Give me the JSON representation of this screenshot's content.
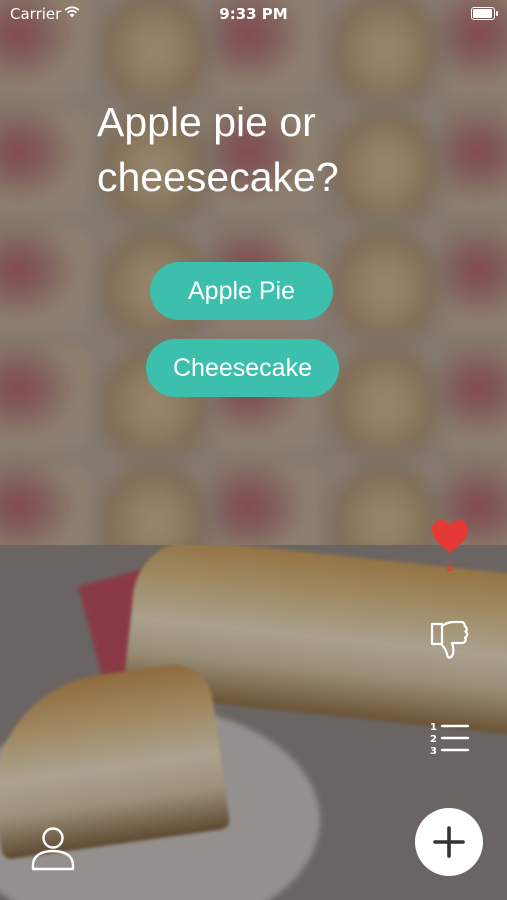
{
  "status_bar": {
    "carrier": "Carrier",
    "time": "9:33 PM",
    "battery_level_percent": 100
  },
  "question": {
    "text": "Apple pie or cheesecake?"
  },
  "answers": [
    {
      "label": "Apple Pie"
    },
    {
      "label": "Cheesecake"
    }
  ],
  "actions": {
    "like_count": "2",
    "like_icon": "heart-icon",
    "dislike_icon": "thumbs-down-icon",
    "ranking_icon": "numbered-list-icon",
    "add_icon": "plus-icon",
    "profile_icon": "user-icon"
  },
  "colors": {
    "answer_button": "#3dbfad",
    "like": "#e53935",
    "text": "#ffffff"
  }
}
